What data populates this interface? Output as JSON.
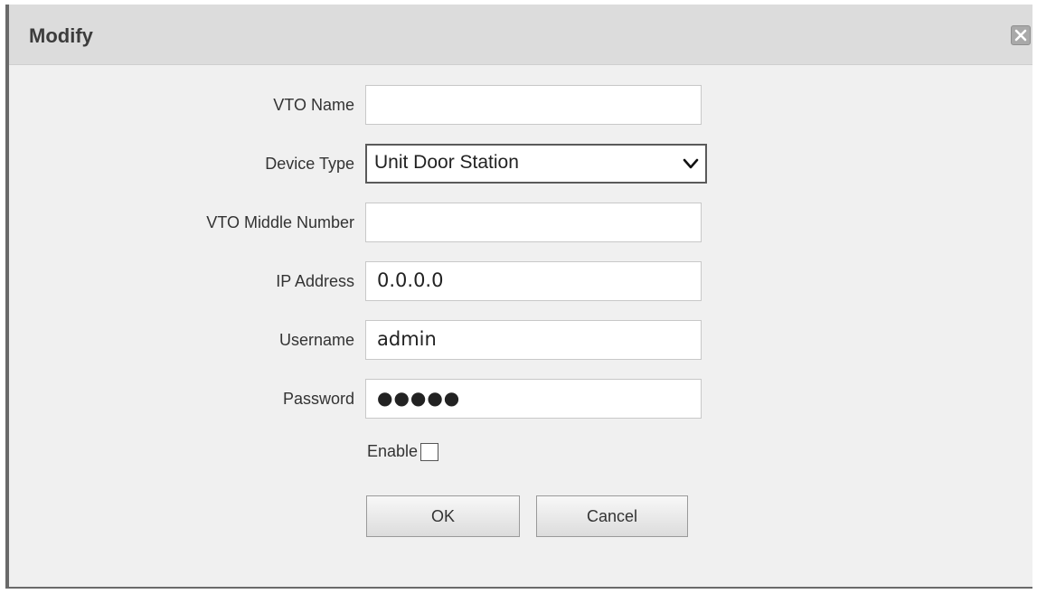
{
  "dialog": {
    "title": "Modify",
    "close_icon": "close-icon"
  },
  "form": {
    "vto_name": {
      "label": "VTO Name",
      "value": ""
    },
    "device_type": {
      "label": "Device Type",
      "value": "Unit Door Station",
      "icon": "chevron-down-icon"
    },
    "vto_middle_number": {
      "label": "VTO Middle Number",
      "value": ""
    },
    "ip_address": {
      "label": "IP Address",
      "value": "0.0.0.0"
    },
    "username": {
      "label": "Username",
      "value": "admin"
    },
    "password": {
      "label": "Password",
      "value": "●●●●●"
    },
    "enable": {
      "label": "Enable",
      "checked": false
    }
  },
  "buttons": {
    "ok": "OK",
    "cancel": "Cancel"
  }
}
